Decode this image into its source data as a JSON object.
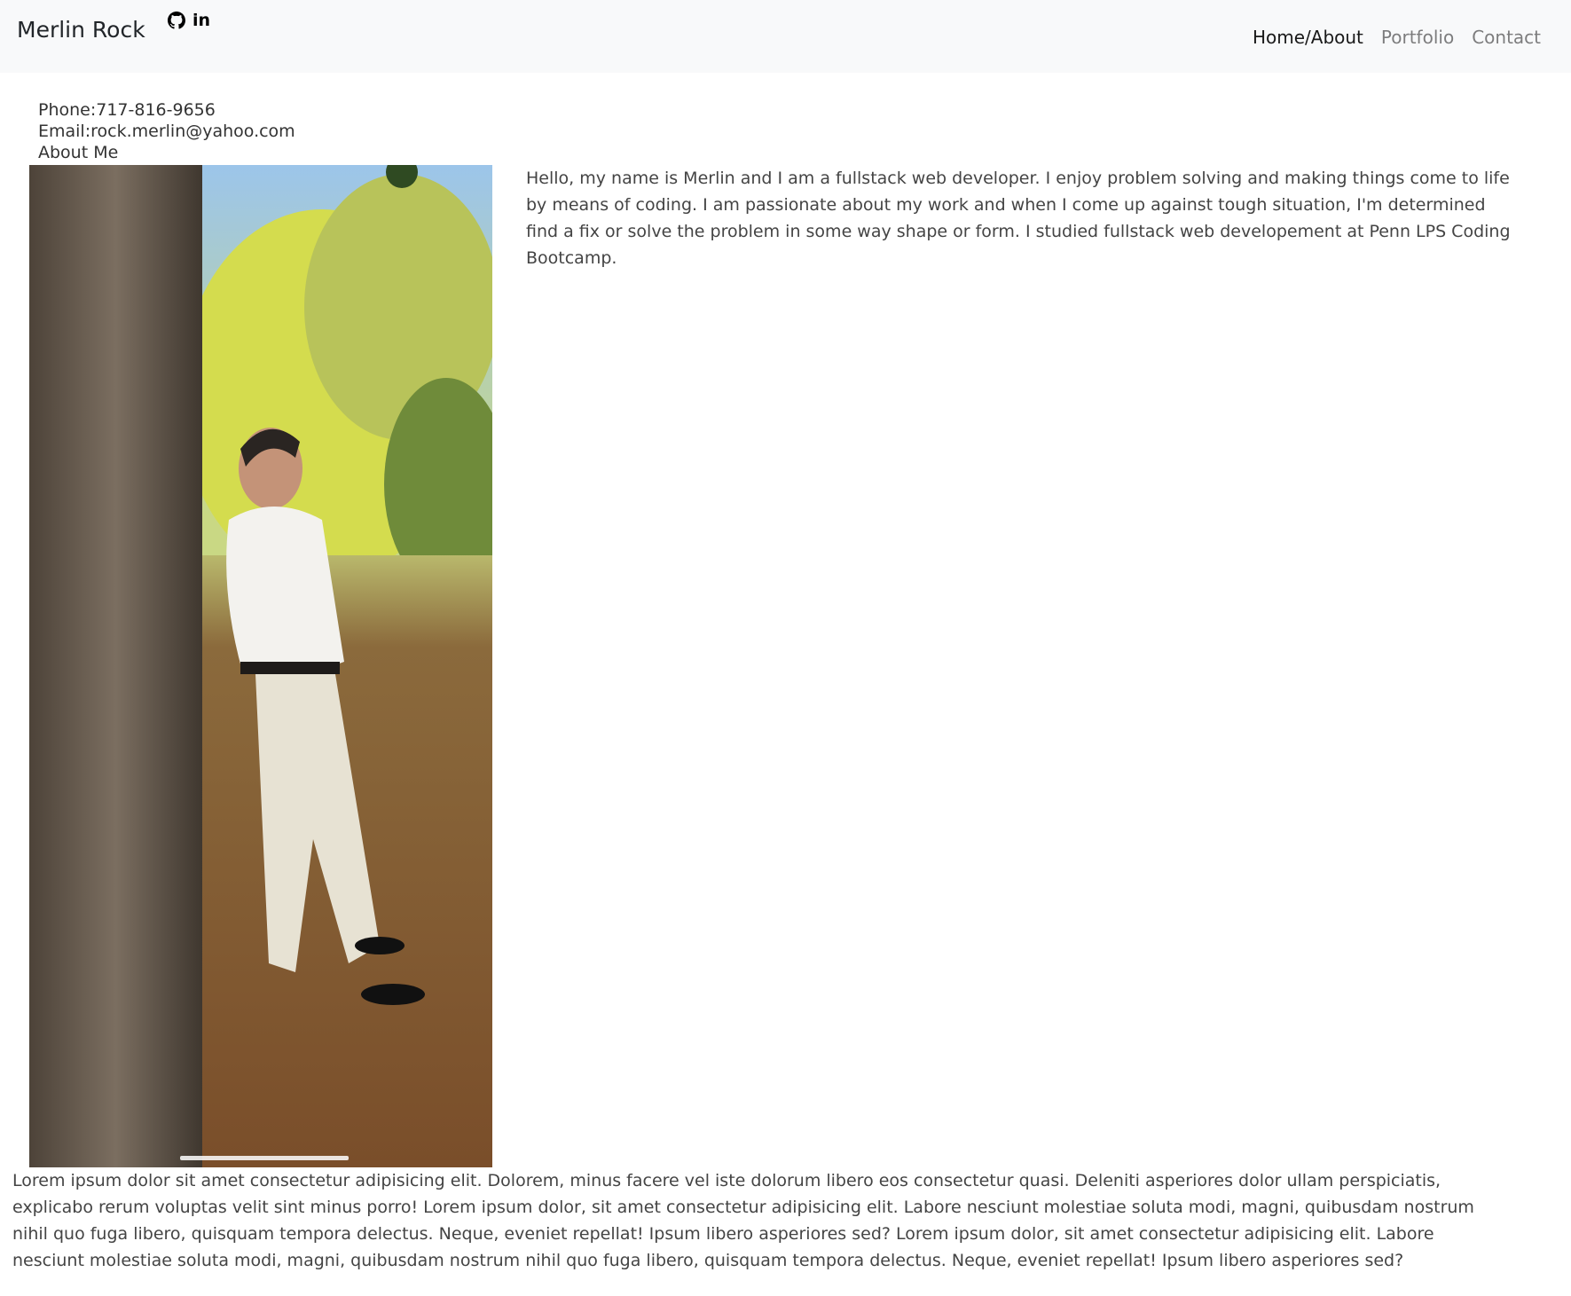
{
  "navbar": {
    "brand": "Merlin Rock",
    "social": {
      "github_icon": "github-icon",
      "linkedin_text": "in"
    },
    "links": [
      {
        "label": "Home/About",
        "active": true
      },
      {
        "label": "Portfolio",
        "active": false
      },
      {
        "label": "Contact",
        "active": false
      }
    ]
  },
  "contact": {
    "phone": "Phone:717-816-9656",
    "email": "Email:rock.merlin@yahoo.com",
    "about_heading": "About Me"
  },
  "bio": {
    "text": "Hello, my name is Merlin and I am a fullstack web developer. I enjoy problem solving and making things come to life by means of coding. I am passionate about my work and when I come up against tough situation, I'm determined find a fix or solve the problem in some way shape or form. I studied fullstack web developement at Penn LPS Coding Bootcamp."
  },
  "lorem": {
    "text": "Lorem ipsum dolor sit amet consectetur adipisicing elit. Dolorem, minus facere vel iste dolorum libero eos consectetur quasi. Deleniti asperiores dolor ullam perspiciatis, explicabo rerum voluptas velit sint minus porro! Lorem ipsum dolor, sit amet consectetur adipisicing elit. Labore nesciunt molestiae soluta modi, magni, quibusdam nostrum nihil quo fuga libero, quisquam tempora delectus. Neque, eveniet repellat! Ipsum libero asperiores sed? Lorem ipsum dolor, sit amet consectetur adipisicing elit. Labore nesciunt molestiae soluta modi, magni, quibusdam nostrum nihil quo fuga libero, quisquam tempora delectus. Neque, eveniet repellat! Ipsum libero asperiores sed?"
  },
  "colors": {
    "navbar_bg": "#f8f9fa",
    "nav_active": "#212529",
    "nav_inactive": "#808080",
    "body_text": "#444444"
  }
}
